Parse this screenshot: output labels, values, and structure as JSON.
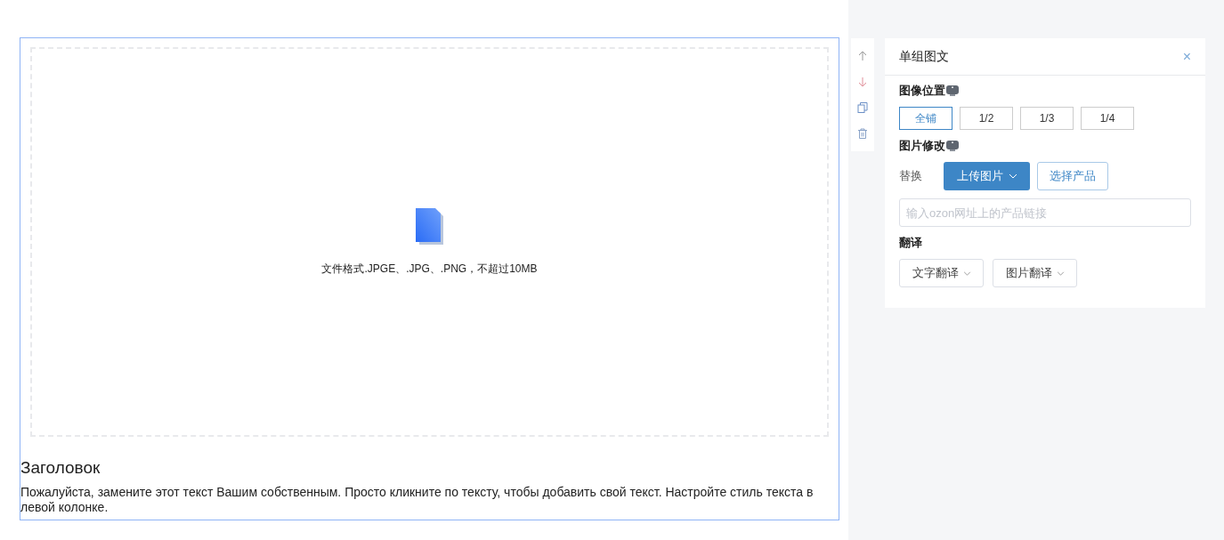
{
  "editor": {
    "upload_hint": "文件格式.JPGE、.JPG、.PNG，不超过10MB",
    "heading": "Заголовок",
    "body": "Пожалуйста, замените этот текст Вашим собственным. Просто кликните по тексту, чтобы добавить свой текст. Настройте стиль текста в левой колонке."
  },
  "panel": {
    "title": "单组图文",
    "close": "×",
    "position": {
      "label": "图像位置",
      "options": [
        {
          "label": "全铺",
          "selected": true
        },
        {
          "label": "1/2",
          "selected": false
        },
        {
          "label": "1/3",
          "selected": false
        },
        {
          "label": "1/4",
          "selected": false
        }
      ]
    },
    "modify": {
      "label": "图片修改",
      "replace_label": "替换",
      "upload_button": "上传图片",
      "choose_button": "选择产品",
      "url_placeholder": "输入ozon网址上的产品链接"
    },
    "translate": {
      "label": "翻译",
      "buttons": [
        "文字翻译",
        "图片翻译"
      ]
    }
  }
}
